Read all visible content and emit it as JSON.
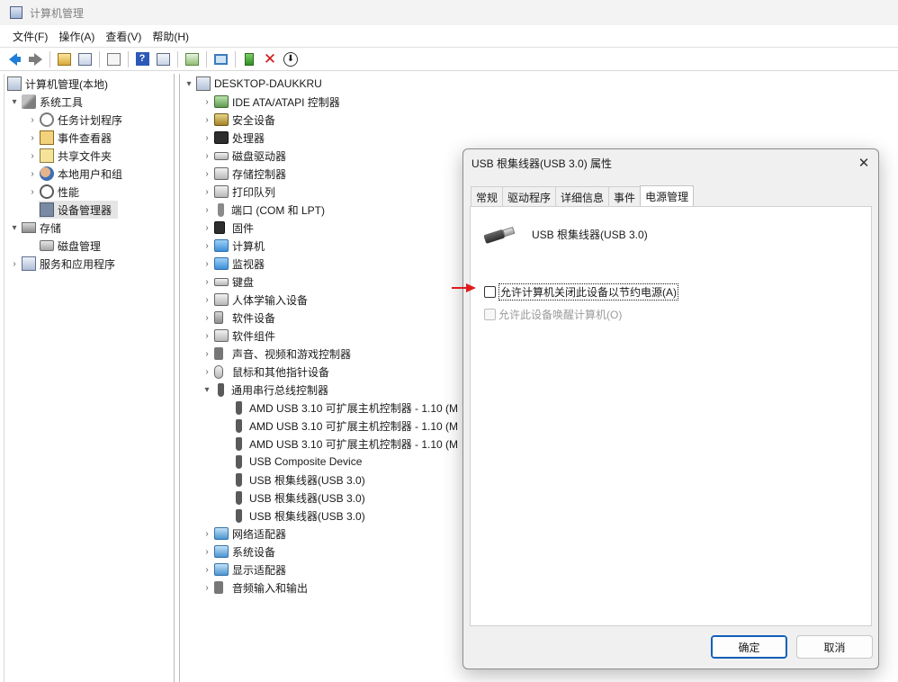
{
  "window": {
    "title": "计算机管理"
  },
  "menu": [
    {
      "label": "文件(F)"
    },
    {
      "label": "操作(A)"
    },
    {
      "label": "查看(V)"
    },
    {
      "label": "帮助(H)"
    }
  ],
  "toolbar": {
    "icons": [
      "back-arrow-icon",
      "forward-arrow-icon",
      "up-folder-icon",
      "show-hide-tree-icon",
      "properties-icon",
      "help-icon",
      "action-pane-icon",
      "export-icon",
      "scan-hardware-icon",
      "enable-device-icon",
      "uninstall-device-icon",
      "disable-device-icon"
    ]
  },
  "left_tree": {
    "root": "计算机管理(本地)",
    "system_tools": "系统工具",
    "task_scheduler": "任务计划程序",
    "event_viewer": "事件查看器",
    "shared_folders": "共享文件夹",
    "local_users": "本地用户和组",
    "performance": "性能",
    "device_manager": "设备管理器",
    "storage": "存储",
    "disk_management": "磁盘管理",
    "services_apps": "服务和应用程序"
  },
  "device_tree": {
    "computer": "DESKTOP-DAUKKRU",
    "categories": [
      {
        "label": "IDE ATA/ATAPI 控制器"
      },
      {
        "label": "安全设备"
      },
      {
        "label": "处理器"
      },
      {
        "label": "磁盘驱动器"
      },
      {
        "label": "存储控制器"
      },
      {
        "label": "打印队列"
      },
      {
        "label": "端口 (COM 和 LPT)"
      },
      {
        "label": "固件"
      },
      {
        "label": "计算机"
      },
      {
        "label": "监视器"
      },
      {
        "label": "键盘"
      },
      {
        "label": "人体学输入设备"
      },
      {
        "label": "软件设备"
      },
      {
        "label": "软件组件"
      },
      {
        "label": "声音、视频和游戏控制器"
      },
      {
        "label": "鼠标和其他指针设备"
      },
      {
        "label": "通用串行总线控制器"
      }
    ],
    "usb_children": [
      {
        "label": "AMD USB 3.10 可扩展主机控制器 - 1.10 (M"
      },
      {
        "label": "AMD USB 3.10 可扩展主机控制器 - 1.10 (M"
      },
      {
        "label": "AMD USB 3.10 可扩展主机控制器 - 1.10 (M"
      },
      {
        "label": "USB Composite Device"
      },
      {
        "label": "USB 根集线器(USB 3.0)"
      },
      {
        "label": "USB 根集线器(USB 3.0)"
      },
      {
        "label": "USB 根集线器(USB 3.0)"
      }
    ],
    "after_usb": [
      {
        "label": "网络适配器"
      },
      {
        "label": "系统设备"
      },
      {
        "label": "显示适配器"
      },
      {
        "label": "音频输入和输出"
      }
    ]
  },
  "dialog": {
    "title": "USB 根集线器(USB 3.0) 属性",
    "tabs": [
      {
        "label": "常规"
      },
      {
        "label": "驱动程序"
      },
      {
        "label": "详细信息"
      },
      {
        "label": "事件"
      },
      {
        "label": "电源管理"
      }
    ],
    "device_name": "USB 根集线器(USB 3.0)",
    "allow_turn_off": "允许计算机关闭此设备以节约电源(A)",
    "allow_wake": "允许此设备唤醒计算机(O)",
    "ok": "确定",
    "cancel": "取消"
  },
  "colors": {
    "accent": "#0f5fb8",
    "annotation_arrow": "#e01b1b"
  }
}
